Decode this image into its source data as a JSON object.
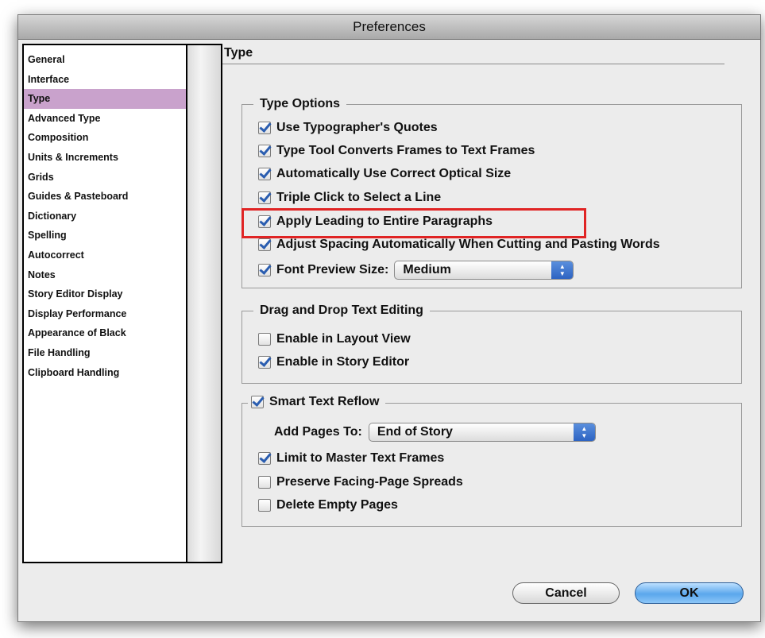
{
  "window": {
    "title": "Preferences"
  },
  "sidebar": {
    "items": [
      {
        "label": "General",
        "selected": false
      },
      {
        "label": "Interface",
        "selected": false
      },
      {
        "label": "Type",
        "selected": true
      },
      {
        "label": "Advanced Type",
        "selected": false
      },
      {
        "label": "Composition",
        "selected": false
      },
      {
        "label": "Units & Increments",
        "selected": false
      },
      {
        "label": "Grids",
        "selected": false
      },
      {
        "label": "Guides & Pasteboard",
        "selected": false
      },
      {
        "label": "Dictionary",
        "selected": false
      },
      {
        "label": "Spelling",
        "selected": false
      },
      {
        "label": "Autocorrect",
        "selected": false
      },
      {
        "label": "Notes",
        "selected": false
      },
      {
        "label": "Story Editor Display",
        "selected": false
      },
      {
        "label": "Display Performance",
        "selected": false
      },
      {
        "label": "Appearance of Black",
        "selected": false
      },
      {
        "label": "File Handling",
        "selected": false
      },
      {
        "label": "Clipboard Handling",
        "selected": false
      }
    ]
  },
  "main": {
    "heading": "Type",
    "type_options": {
      "title": "Type Options",
      "options": [
        {
          "label": "Use Typographer's Quotes",
          "checked": true
        },
        {
          "label": "Type Tool Converts Frames to Text Frames",
          "checked": true
        },
        {
          "label": "Automatically Use Correct Optical Size",
          "checked": true
        },
        {
          "label": "Triple Click to Select a Line",
          "checked": true
        },
        {
          "label": "Apply Leading to Entire Paragraphs",
          "checked": true
        },
        {
          "label": "Adjust Spacing Automatically When Cutting and Pasting Words",
          "checked": true
        }
      ],
      "font_preview": {
        "label": "Font Preview Size:",
        "checked": true,
        "value": "Medium"
      }
    },
    "drag_drop": {
      "title": "Drag and Drop Text Editing",
      "options": [
        {
          "label": "Enable in Layout View",
          "checked": false
        },
        {
          "label": "Enable in Story Editor",
          "checked": true
        }
      ]
    },
    "smart_reflow": {
      "title": "Smart Text Reflow",
      "checked": true,
      "add_pages": {
        "label": "Add Pages To:",
        "value": "End of Story"
      },
      "options": [
        {
          "label": "Limit to Master Text Frames",
          "checked": true
        },
        {
          "label": "Preserve Facing-Page Spreads",
          "checked": false
        },
        {
          "label": "Delete Empty Pages",
          "checked": false
        }
      ]
    }
  },
  "buttons": {
    "cancel": "Cancel",
    "ok": "OK"
  },
  "colors": {
    "selection": "#c9a2cc",
    "highlight_box": "#e02424",
    "default_button": "#5aa7ec",
    "checkmark": "#2a5db0"
  }
}
